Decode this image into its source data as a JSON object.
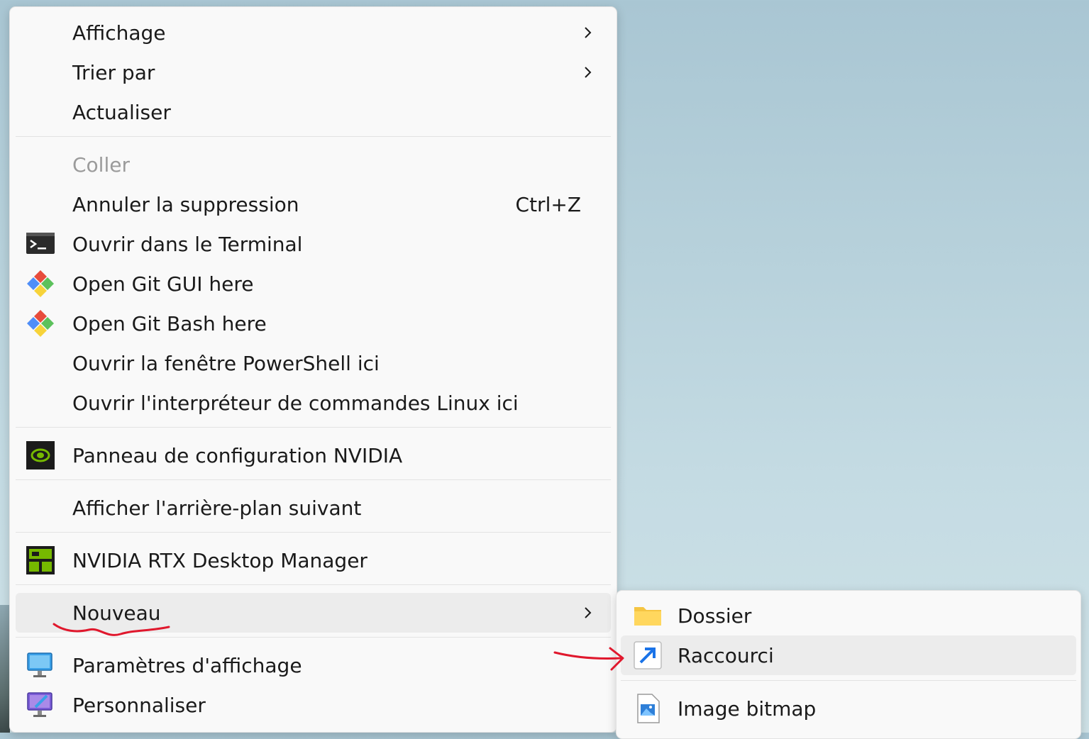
{
  "desktop_menu": {
    "items": [
      {
        "label": "Affichage",
        "submenu": true
      },
      {
        "label": "Trier par",
        "submenu": true
      },
      {
        "label": "Actualiser"
      },
      {
        "label": "Coller",
        "disabled": true
      },
      {
        "label": "Annuler la suppression",
        "shortcut": "Ctrl+Z"
      },
      {
        "label": "Ouvrir dans le Terminal",
        "icon": "terminal-icon"
      },
      {
        "label": "Open Git GUI here",
        "icon": "git-gui-icon"
      },
      {
        "label": "Open Git Bash here",
        "icon": "git-bash-icon"
      },
      {
        "label": "Ouvrir la fenêtre PowerShell ici"
      },
      {
        "label": "Ouvrir l'interpréteur de commandes Linux ici"
      },
      {
        "label": "Panneau de configuration NVIDIA",
        "icon": "nvidia-icon"
      },
      {
        "label": "Afficher l'arrière-plan suivant"
      },
      {
        "label": "NVIDIA RTX Desktop Manager",
        "icon": "nvidia-rtx-desktop-icon"
      },
      {
        "label": "Nouveau",
        "submenu": true,
        "active": true
      },
      {
        "label": "Paramètres d'affichage",
        "icon": "display-settings-icon"
      },
      {
        "label": "Personnaliser",
        "icon": "personalize-icon"
      }
    ]
  },
  "new_submenu": {
    "items": [
      {
        "label": "Dossier",
        "icon": "folder-icon"
      },
      {
        "label": "Raccourci",
        "icon": "shortcut-icon",
        "active": true
      },
      {
        "label": "Image bitmap",
        "icon": "bitmap-image-icon"
      }
    ]
  },
  "colors": {
    "menu_bg": "#f9f9f9",
    "active_bg": "#ececec",
    "annotation_red": "#e0182d",
    "nvidia_green": "#76b900"
  }
}
